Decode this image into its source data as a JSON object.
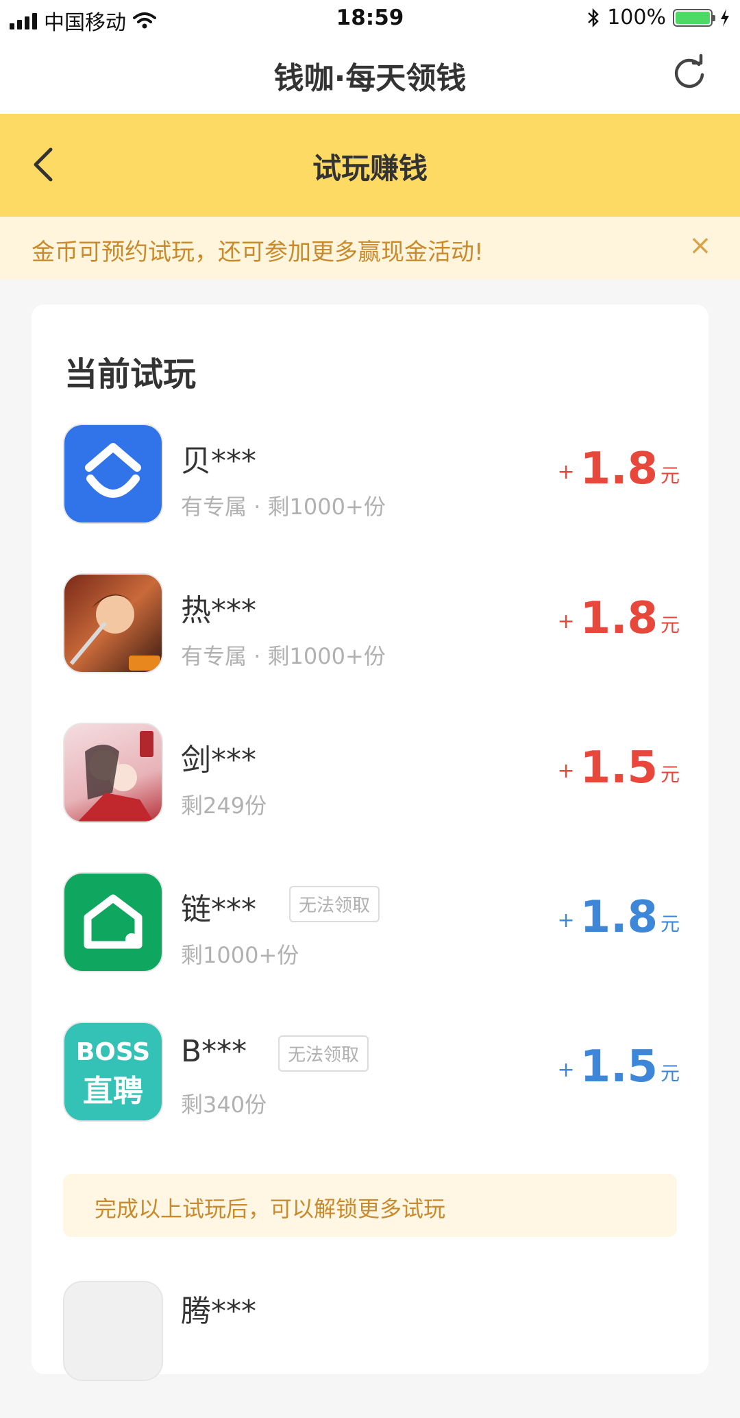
{
  "status_bar": {
    "carrier": "中国移动",
    "time": "18:59",
    "battery": "100%"
  },
  "app_bar": {
    "title": "钱咖·每天领钱",
    "refresh_icon": "refresh-icon"
  },
  "page_header": {
    "title": "试玩赚钱",
    "back_icon": "chevron-left-icon"
  },
  "notice": {
    "text": "金币可预约试玩，还可参加更多赢现金活动!",
    "close_icon": "close-icon"
  },
  "section": {
    "title": "当前试玩"
  },
  "items": [
    {
      "name": "贝***",
      "sub": "有专属 · 剩1000+份",
      "plus": "+",
      "amount": "1.8",
      "unit": "元",
      "tag": "",
      "color": "#e8473c",
      "icon": "beike-icon"
    },
    {
      "name": "热***",
      "sub": "有专属 · 剩1000+份",
      "plus": "+",
      "amount": "1.8",
      "unit": "元",
      "tag": "",
      "color": "#e8473c",
      "icon": "game-hero-icon"
    },
    {
      "name": "剑***",
      "sub": "剩249份",
      "plus": "+",
      "amount": "1.5",
      "unit": "元",
      "tag": "",
      "color": "#e8473c",
      "icon": "game-romance-icon"
    },
    {
      "name": "链***",
      "sub": "剩1000+份",
      "plus": "+",
      "amount": "1.8",
      "unit": "元",
      "tag": "无法领取",
      "color": "#3d86d8",
      "icon": "lianjia-house-icon"
    },
    {
      "name": "B***",
      "sub": "剩340份",
      "plus": "+",
      "amount": "1.5",
      "unit": "元",
      "tag": "无法领取",
      "color": "#3d86d8",
      "icon": "boss-zhipin-icon",
      "icon_text_top": "BOSS",
      "icon_text_bottom": "直聘"
    }
  ],
  "unlock": {
    "text": "完成以上试玩后，可以解锁更多试玩"
  },
  "peek_item": {
    "name": "腾***"
  },
  "colors": {
    "yellow": "#fcda64",
    "red": "#e8473c",
    "blue": "#3d86d8",
    "notice_text": "#c98a2c"
  }
}
